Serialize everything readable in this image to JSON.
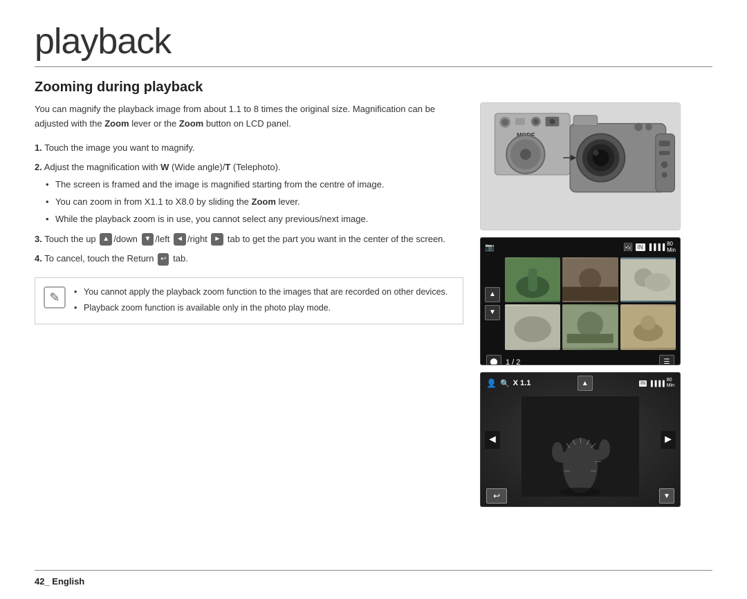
{
  "page": {
    "title": "playback",
    "footer_text": "42_ English",
    "divider": true
  },
  "section": {
    "title": "Zooming during playback",
    "intro": "You can magnify the playback image from about 1.1 to 8 times the original size. Magnification can be adjusted with the Zoom lever or the Zoom button on LCD panel.",
    "steps": [
      {
        "num": "1.",
        "text": "Touch the image you want to magnify."
      },
      {
        "num": "2.",
        "text": "Adjust the magnification with W (Wide angle)/T (Telephoto).",
        "sub_bullets": [
          "The screen is framed and the image is magnified starting from the centre of image.",
          "You can zoom in from X1.1 to X8.0 by sliding the Zoom lever.",
          "While the playback zoom is in use, you cannot select any previous/next image."
        ]
      },
      {
        "num": "3.",
        "text": "Touch the up (▲)/down (▼)/left (◄)/right (►) tab to get the part you want in the center of the screen."
      },
      {
        "num": "4.",
        "text": "To cancel, touch the Return (↩) tab."
      }
    ],
    "note_bullets": [
      "You cannot apply the playback zoom function to the images that are recorded on other devices.",
      "Playback zoom function is available only in the photo play mode."
    ]
  },
  "images": {
    "camera_label": "MODE",
    "thumbnail_page": "1 / 2",
    "zoom_level": "X 1.1",
    "status_icons": "IN",
    "battery_time": "80 Min"
  }
}
